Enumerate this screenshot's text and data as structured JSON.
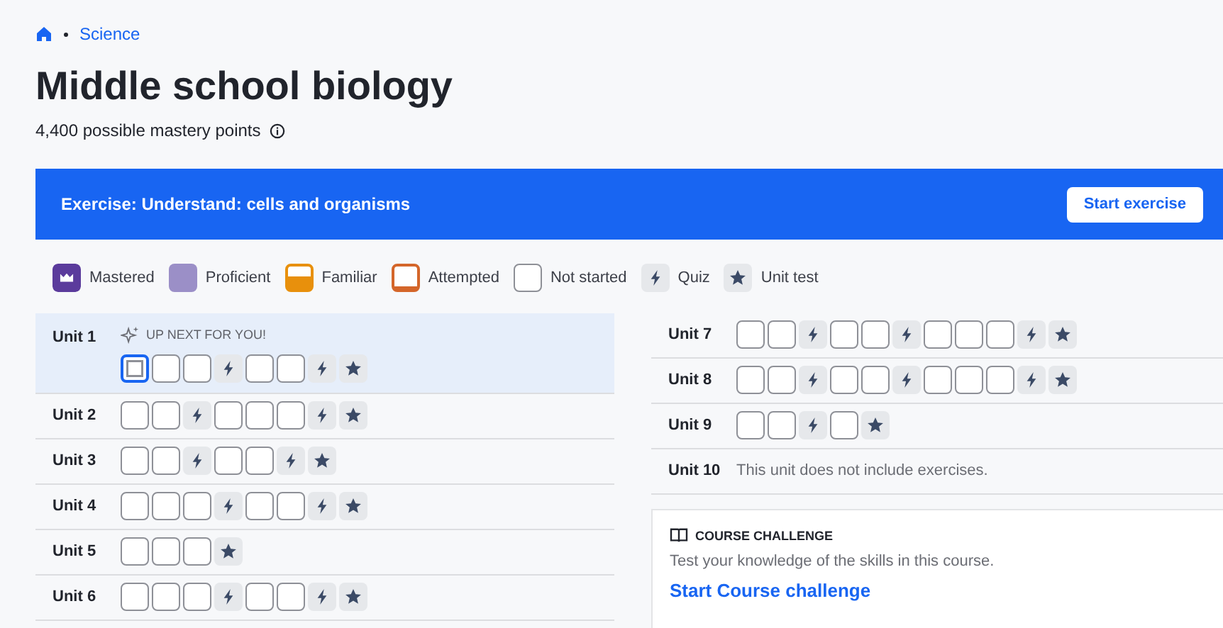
{
  "breadcrumb": {
    "items": [
      "Science"
    ]
  },
  "title": "Middle school biology",
  "subtitle": "4,400 possible mastery points",
  "banner": {
    "text": "Exercise: Understand: cells and organisms",
    "button": "Start exercise"
  },
  "legend": [
    {
      "kind": "mastered",
      "label": "Mastered"
    },
    {
      "kind": "proficient",
      "label": "Proficient"
    },
    {
      "kind": "familiar",
      "label": "Familiar"
    },
    {
      "kind": "attempted",
      "label": "Attempted"
    },
    {
      "kind": "not_started",
      "label": "Not started"
    },
    {
      "kind": "quiz",
      "label": "Quiz"
    },
    {
      "kind": "unit_test",
      "label": "Unit test"
    }
  ],
  "units_left": [
    {
      "label": "Unit 1",
      "highlighted": true,
      "up_next": "UP NEXT FOR YOU!",
      "items": [
        {
          "kind": "exercise",
          "selected": true
        },
        {
          "kind": "exercise",
          "selected": false
        },
        {
          "kind": "exercise",
          "selected": false
        },
        {
          "kind": "quiz",
          "selected": false
        },
        {
          "kind": "exercise",
          "selected": false
        },
        {
          "kind": "exercise",
          "selected": false
        },
        {
          "kind": "quiz",
          "selected": false
        },
        {
          "kind": "unit_test",
          "selected": false
        }
      ]
    },
    {
      "label": "Unit 2",
      "highlighted": false,
      "items": [
        {
          "kind": "exercise",
          "selected": false
        },
        {
          "kind": "exercise",
          "selected": false
        },
        {
          "kind": "quiz",
          "selected": false
        },
        {
          "kind": "exercise",
          "selected": false
        },
        {
          "kind": "exercise",
          "selected": false
        },
        {
          "kind": "exercise",
          "selected": false
        },
        {
          "kind": "quiz",
          "selected": false
        },
        {
          "kind": "unit_test",
          "selected": false
        }
      ]
    },
    {
      "label": "Unit 3",
      "highlighted": false,
      "items": [
        {
          "kind": "exercise",
          "selected": false
        },
        {
          "kind": "exercise",
          "selected": false
        },
        {
          "kind": "quiz",
          "selected": false
        },
        {
          "kind": "exercise",
          "selected": false
        },
        {
          "kind": "exercise",
          "selected": false
        },
        {
          "kind": "quiz",
          "selected": false
        },
        {
          "kind": "unit_test",
          "selected": false
        }
      ]
    },
    {
      "label": "Unit 4",
      "highlighted": false,
      "items": [
        {
          "kind": "exercise",
          "selected": false
        },
        {
          "kind": "exercise",
          "selected": false
        },
        {
          "kind": "exercise",
          "selected": false
        },
        {
          "kind": "quiz",
          "selected": false
        },
        {
          "kind": "exercise",
          "selected": false
        },
        {
          "kind": "exercise",
          "selected": false
        },
        {
          "kind": "quiz",
          "selected": false
        },
        {
          "kind": "unit_test",
          "selected": false
        }
      ]
    },
    {
      "label": "Unit 5",
      "highlighted": false,
      "items": [
        {
          "kind": "exercise",
          "selected": false
        },
        {
          "kind": "exercise",
          "selected": false
        },
        {
          "kind": "exercise",
          "selected": false
        },
        {
          "kind": "unit_test",
          "selected": false
        }
      ]
    },
    {
      "label": "Unit 6",
      "highlighted": false,
      "items": [
        {
          "kind": "exercise",
          "selected": false
        },
        {
          "kind": "exercise",
          "selected": false
        },
        {
          "kind": "exercise",
          "selected": false
        },
        {
          "kind": "quiz",
          "selected": false
        },
        {
          "kind": "exercise",
          "selected": false
        },
        {
          "kind": "exercise",
          "selected": false
        },
        {
          "kind": "quiz",
          "selected": false
        },
        {
          "kind": "unit_test",
          "selected": false
        }
      ]
    }
  ],
  "units_right": [
    {
      "label": "Unit 7",
      "highlighted": false,
      "items": [
        {
          "kind": "exercise",
          "selected": false
        },
        {
          "kind": "exercise",
          "selected": false
        },
        {
          "kind": "quiz",
          "selected": false
        },
        {
          "kind": "exercise",
          "selected": false
        },
        {
          "kind": "exercise",
          "selected": false
        },
        {
          "kind": "quiz",
          "selected": false
        },
        {
          "kind": "exercise",
          "selected": false
        },
        {
          "kind": "exercise",
          "selected": false
        },
        {
          "kind": "exercise",
          "selected": false
        },
        {
          "kind": "quiz",
          "selected": false
        },
        {
          "kind": "unit_test",
          "selected": false
        }
      ]
    },
    {
      "label": "Unit 8",
      "highlighted": false,
      "items": [
        {
          "kind": "exercise",
          "selected": false
        },
        {
          "kind": "exercise",
          "selected": false
        },
        {
          "kind": "quiz",
          "selected": false
        },
        {
          "kind": "exercise",
          "selected": false
        },
        {
          "kind": "exercise",
          "selected": false
        },
        {
          "kind": "quiz",
          "selected": false
        },
        {
          "kind": "exercise",
          "selected": false
        },
        {
          "kind": "exercise",
          "selected": false
        },
        {
          "kind": "exercise",
          "selected": false
        },
        {
          "kind": "quiz",
          "selected": false
        },
        {
          "kind": "unit_test",
          "selected": false
        }
      ]
    },
    {
      "label": "Unit 9",
      "highlighted": false,
      "items": [
        {
          "kind": "exercise",
          "selected": false
        },
        {
          "kind": "exercise",
          "selected": false
        },
        {
          "kind": "quiz",
          "selected": false
        },
        {
          "kind": "exercise",
          "selected": false
        },
        {
          "kind": "unit_test",
          "selected": false
        }
      ]
    },
    {
      "label": "Unit 10",
      "highlighted": false,
      "note": "This unit does not include exercises."
    }
  ],
  "course_challenge": {
    "heading": "COURSE CHALLENGE",
    "text": "Test your knowledge of the skills in this course.",
    "link": "Start Course challenge"
  }
}
